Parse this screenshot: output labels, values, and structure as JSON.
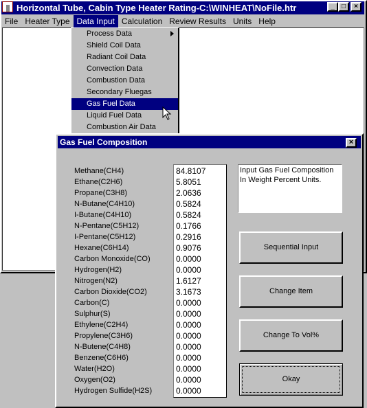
{
  "app": {
    "title": "Horizontal Tube, Cabin Type Heater Rating-C:\\WINHEAT\\NoFile.htr",
    "min": "_",
    "max": "□",
    "close": "×"
  },
  "menu": [
    "File",
    "Heater Type",
    "Data Input",
    "Calculation",
    "Review Results",
    "Units",
    "Help"
  ],
  "dropdown": [
    "Process Data",
    "Shield Coil Data",
    "Radiant Coil Data",
    "Convection Data",
    "Combustion Data",
    "Secondary Fluegas",
    "Gas Fuel Data",
    "Liquid Fuel Data",
    "Combustion Air Data"
  ],
  "dialog": {
    "title": "Gas Fuel Composition",
    "close": "×",
    "components": [
      "Methane(CH4)",
      "Ethane(C2H6)",
      "Propane(C3H8)",
      "N-Butane(C4H10)",
      "I-Butane(C4H10)",
      "N-Pentane(C5H12)",
      "I-Pentane(C5H12)",
      "Hexane(C6H14)",
      "Carbon Monoxide(CO)",
      "Hydrogen(H2)",
      "Nitrogen(N2)",
      "Carbon Dioxide(CO2)",
      "Carbon(C)",
      "Sulphur(S)",
      "Ethylene(C2H4)",
      "Propylene(C3H6)",
      "N-Butene(C4H8)",
      "Benzene(C6H6)",
      "Water(H2O)",
      "Oxygen(O2)",
      "Hydrogen Sulfide(H2S)"
    ],
    "values": [
      "84.8107",
      "5.8051",
      "2.0636",
      "0.5824",
      "0.5824",
      "0.1766",
      "0.2916",
      "0.9076",
      "0.0000",
      "0.0000",
      "1.6127",
      "3.1673",
      "0.0000",
      "0.0000",
      "0.0000",
      "0.0000",
      "0.0000",
      "0.0000",
      "0.0000",
      "0.0000",
      "0.0000"
    ],
    "info": "Input Gas Fuel Composition In Weight Percent Units.",
    "buttons": {
      "sequential": "Sequential Input",
      "change": "Change Item",
      "vol": "Change To Vol%",
      "okay": "Okay"
    }
  }
}
